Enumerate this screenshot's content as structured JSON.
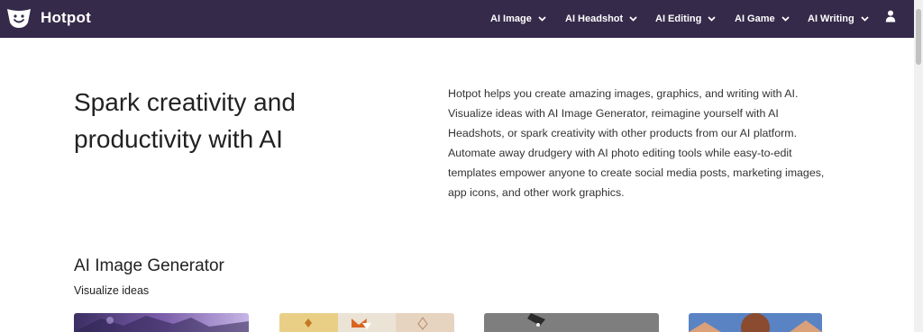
{
  "brand": {
    "name": "Hotpot"
  },
  "nav": {
    "items": [
      {
        "label": "AI Image"
      },
      {
        "label": "AI Headshot"
      },
      {
        "label": "AI Editing"
      },
      {
        "label": "AI Game"
      },
      {
        "label": "AI Writing"
      }
    ],
    "user_icon": "user-icon",
    "chevron_icon": "chevron-down-icon"
  },
  "hero": {
    "title": "Spark creativity and productivity with AI",
    "description": "Hotpot helps you create amazing images, graphics, and writing with AI. Visualize ideas with AI Image Generator, reimagine yourself with AI Headshots, or spark creativity with other products from our AI platform. Automate away drudgery with AI photo editing tools while easy-to-edit templates empower anyone to create social media posts, marketing images, app icons, and other work graphics."
  },
  "section": {
    "title": "AI Image Generator",
    "subtitle": "Visualize ideas"
  },
  "colors": {
    "nav_bg": "#352a4a",
    "text": "#222222"
  }
}
